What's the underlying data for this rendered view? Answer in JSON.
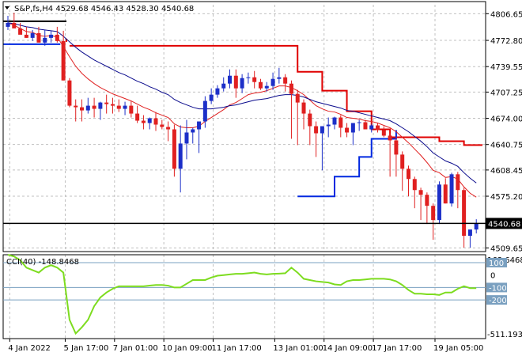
{
  "header": {
    "symbol": "S&P,fs,H4",
    "ohlc": "4529.68 4546.43 4528.30 4540.68"
  },
  "colors": {
    "background": "#ffffff",
    "grid": "#c0c0c0",
    "bull": "#1c2fc8",
    "bear": "#e02020",
    "ema_fast": "#e02020",
    "ema_slow": "#0a0a8c",
    "stop_up": "#e00000",
    "stop_down": "#0028e0",
    "cci": "#7ddc1f",
    "levels": "#7aa0c0",
    "price_tag_bg": "#000000"
  },
  "chart_data": [
    {
      "type": "candlestick",
      "title": "S&P,fs,H4",
      "ohlc_readout": "4529.68 4546.43 4528.30 4540.68",
      "x_ticks": [
        "4 Jan 2022",
        "5 Jan 17:00",
        "7 Jan 01:00",
        "10 Jan 09:00",
        "11 Jan 17:00",
        "13 Jan 01:00",
        "14 Jan 09:00",
        "17 Jan 17:00",
        "19 Jan 05:00"
      ],
      "y_ticks": [
        "4806.65",
        "4772.80",
        "4739.55",
        "4707.25",
        "4674.00",
        "4640.75",
        "4608.45",
        "4575.20",
        "4509.65"
      ],
      "y_range": [
        4505,
        4818
      ],
      "grid": true,
      "current_price": {
        "label": "4540.68",
        "value": 4540.68
      },
      "candles": {
        "open": [
          4790,
          4795,
          4788,
          4780,
          4776,
          4782,
          4770,
          4776,
          4780,
          4772,
          4722,
          4690,
          4688,
          4684,
          4690,
          4686,
          4694,
          4692,
          4690,
          4686,
          4690,
          4680,
          4671,
          4668,
          4674,
          4666,
          4663,
          4660,
          4610,
          4642,
          4656,
          4660,
          4670,
          4696,
          4704,
          4712,
          4718,
          4728,
          4712,
          4725,
          4726,
          4720,
          4712,
          4715,
          4724,
          4726,
          4718,
          4705,
          4694,
          4680,
          4664,
          4655,
          4664,
          4666,
          4675,
          4662,
          4656,
          4668,
          4669,
          4660,
          4665,
          4659,
          4652,
          4646,
          4628,
          4610,
          4597,
          4583,
          4577,
          4563,
          4545,
          4590,
          4566,
          4603,
          4583,
          4525,
          4533
        ],
        "high": [
          4804,
          4808,
          4795,
          4790,
          4786,
          4790,
          4786,
          4785,
          4790,
          4785,
          4725,
          4698,
          4698,
          4700,
          4700,
          4695,
          4704,
          4700,
          4698,
          4695,
          4696,
          4690,
          4678,
          4675,
          4682,
          4672,
          4670,
          4666,
          4665,
          4672,
          4662,
          4670,
          4702,
          4712,
          4716,
          4726,
          4736,
          4736,
          4730,
          4732,
          4734,
          4724,
          4720,
          4732,
          4738,
          4730,
          4722,
          4710,
          4698,
          4685,
          4670,
          4660,
          4675,
          4676,
          4678,
          4668,
          4668,
          4672,
          4672,
          4667,
          4668,
          4664,
          4655,
          4650,
          4632,
          4614,
          4600,
          4586,
          4580,
          4566,
          4594,
          4598,
          4605,
          4606,
          4586,
          4530,
          4546
        ],
        "low": [
          4786,
          4792,
          4782,
          4776,
          4772,
          4778,
          4766,
          4770,
          4770,
          4722,
          4688,
          4670,
          4670,
          4680,
          4675,
          4672,
          4680,
          4680,
          4682,
          4678,
          4675,
          4668,
          4660,
          4660,
          4658,
          4660,
          4645,
          4600,
          4580,
          4622,
          4642,
          4630,
          4662,
          4692,
          4700,
          4708,
          4712,
          4700,
          4706,
          4718,
          4712,
          4710,
          4708,
          4710,
          4718,
          4708,
          4648,
          4640,
          4660,
          4640,
          4625,
          4608,
          4650,
          4660,
          4650,
          4650,
          4640,
          4658,
          4662,
          4656,
          4656,
          4650,
          4600,
          4600,
          4582,
          4575,
          4560,
          4545,
          4540,
          4520,
          4540,
          4566,
          4562,
          4560,
          4510,
          4510,
          4528
        ],
        "close": [
          4795,
          4788,
          4780,
          4776,
          4782,
          4770,
          4776,
          4780,
          4772,
          4722,
          4690,
          4688,
          4684,
          4690,
          4686,
          4694,
          4692,
          4690,
          4686,
          4690,
          4680,
          4671,
          4668,
          4674,
          4666,
          4663,
          4660,
          4610,
          4642,
          4656,
          4660,
          4670,
          4696,
          4704,
          4712,
          4718,
          4728,
          4712,
          4725,
          4726,
          4720,
          4712,
          4715,
          4724,
          4726,
          4718,
          4705,
          4694,
          4680,
          4664,
          4655,
          4664,
          4666,
          4675,
          4662,
          4656,
          4668,
          4669,
          4660,
          4665,
          4659,
          4652,
          4646,
          4628,
          4610,
          4597,
          4583,
          4577,
          4563,
          4545,
          4590,
          4566,
          4603,
          4583,
          4525,
          4533,
          4541
        ]
      },
      "ema_fast": [
        4795,
        4792,
        4788,
        4784,
        4783,
        4779,
        4778,
        4779,
        4777,
        4765,
        4752,
        4740,
        4731,
        4724,
        4718,
        4713,
        4709,
        4705,
        4702,
        4699,
        4696,
        4692,
        4688,
        4685,
        4681,
        4678,
        4675,
        4667,
        4663,
        4662,
        4662,
        4664,
        4670,
        4675,
        4680,
        4685,
        4691,
        4694,
        4699,
        4704,
        4706,
        4707,
        4709,
        4712,
        4715,
        4715,
        4713,
        4709,
        4704,
        4697,
        4690,
        4686,
        4683,
        4682,
        4679,
        4675,
        4674,
        4673,
        4671,
        4670,
        4668,
        4665,
        4662,
        4657,
        4650,
        4643,
        4635,
        4627,
        4618,
        4608,
        4605,
        4599,
        4600,
        4597,
        4587,
        4579,
        4574
      ],
      "ema_slow": [
        4795,
        4794,
        4792,
        4790,
        4789,
        4787,
        4786,
        4785,
        4784,
        4778,
        4771,
        4764,
        4758,
        4753,
        4748,
        4744,
        4740,
        4736,
        4732,
        4729,
        4725,
        4721,
        4718,
        4714,
        4711,
        4707,
        4704,
        4698,
        4694,
        4691,
        4688,
        4686,
        4686,
        4686,
        4687,
        4688,
        4690,
        4691,
        4693,
        4695,
        4697,
        4698,
        4699,
        4701,
        4703,
        4704,
        4704,
        4703,
        4701,
        4698,
        4695,
        4693,
        4691,
        4689,
        4687,
        4684,
        4683,
        4681,
        4679,
        4677,
        4675,
        4673,
        4671,
        4667,
        4662,
        4657,
        4651,
        4645,
        4638,
        4630,
        4625,
        4620,
        4617,
        4613,
        4605,
        4598,
        4592
      ],
      "stop_up": [
        [
          14,
          4778
        ],
        [
          38,
          4778
        ],
        [
          38,
          4770
        ],
        [
          59,
          4770
        ],
        [
          59,
          4762
        ],
        [
          67,
          4762
        ],
        [
          67,
          4793
        ],
        [
          76,
          4793
        ],
        [
          76,
          4776
        ]
      ],
      "stop_down": [
        [
          47,
          4575
        ],
        [
          53,
          4575
        ],
        [
          53,
          4600
        ],
        [
          57,
          4600
        ],
        [
          57,
          4625
        ],
        [
          59,
          4625
        ],
        [
          59,
          4648
        ],
        [
          63,
          4648
        ],
        [
          63,
          4659
        ]
      ],
      "red_stop_segments": [
        [
          [
            9.5,
            4775
          ],
          [
            9.5,
            4771
          ]
        ],
        [
          [
            10,
            4766
          ],
          [
            47,
            4766
          ],
          [
            47,
            4733
          ],
          [
            51,
            4733
          ],
          [
            51,
            4709
          ],
          [
            55,
            4709
          ],
          [
            55,
            4683
          ],
          [
            59,
            4683
          ],
          [
            59,
            4660
          ],
          [
            62,
            4660
          ],
          [
            62,
            4650
          ],
          [
            70,
            4650
          ],
          [
            70,
            4645
          ],
          [
            74,
            4645
          ],
          [
            74,
            4640
          ],
          [
            77,
            4640
          ]
        ]
      ]
    },
    {
      "type": "line",
      "title": "CCI(40) -148.8468",
      "indicator": "CCI(40)",
      "readout": "-148.8468",
      "y_ticks": [
        "163.6468",
        "100",
        "0",
        "-100",
        "-200",
        "-511.1939"
      ],
      "y_range": [
        -511.1939,
        163.6468
      ],
      "levels": [
        100,
        -100,
        -200
      ],
      "values": [
        170,
        150,
        120,
        60,
        40,
        20,
        60,
        80,
        60,
        20,
        -360,
        -470,
        -420,
        -360,
        -250,
        -180,
        -140,
        -110,
        -90,
        -90,
        -90,
        -90,
        -90,
        -85,
        -80,
        -80,
        -85,
        -100,
        -100,
        -70,
        -40,
        -40,
        -40,
        -20,
        -5,
        0,
        5,
        10,
        10,
        15,
        20,
        10,
        5,
        10,
        12,
        15,
        60,
        20,
        -30,
        -40,
        -50,
        -55,
        -60,
        -75,
        -80,
        -50,
        -40,
        -40,
        -35,
        -30,
        -30,
        -30,
        -35,
        -50,
        -80,
        -120,
        -150,
        -150,
        -155,
        -155,
        -160,
        -140,
        -140,
        -110,
        -90,
        -105,
        -105
      ]
    }
  ]
}
